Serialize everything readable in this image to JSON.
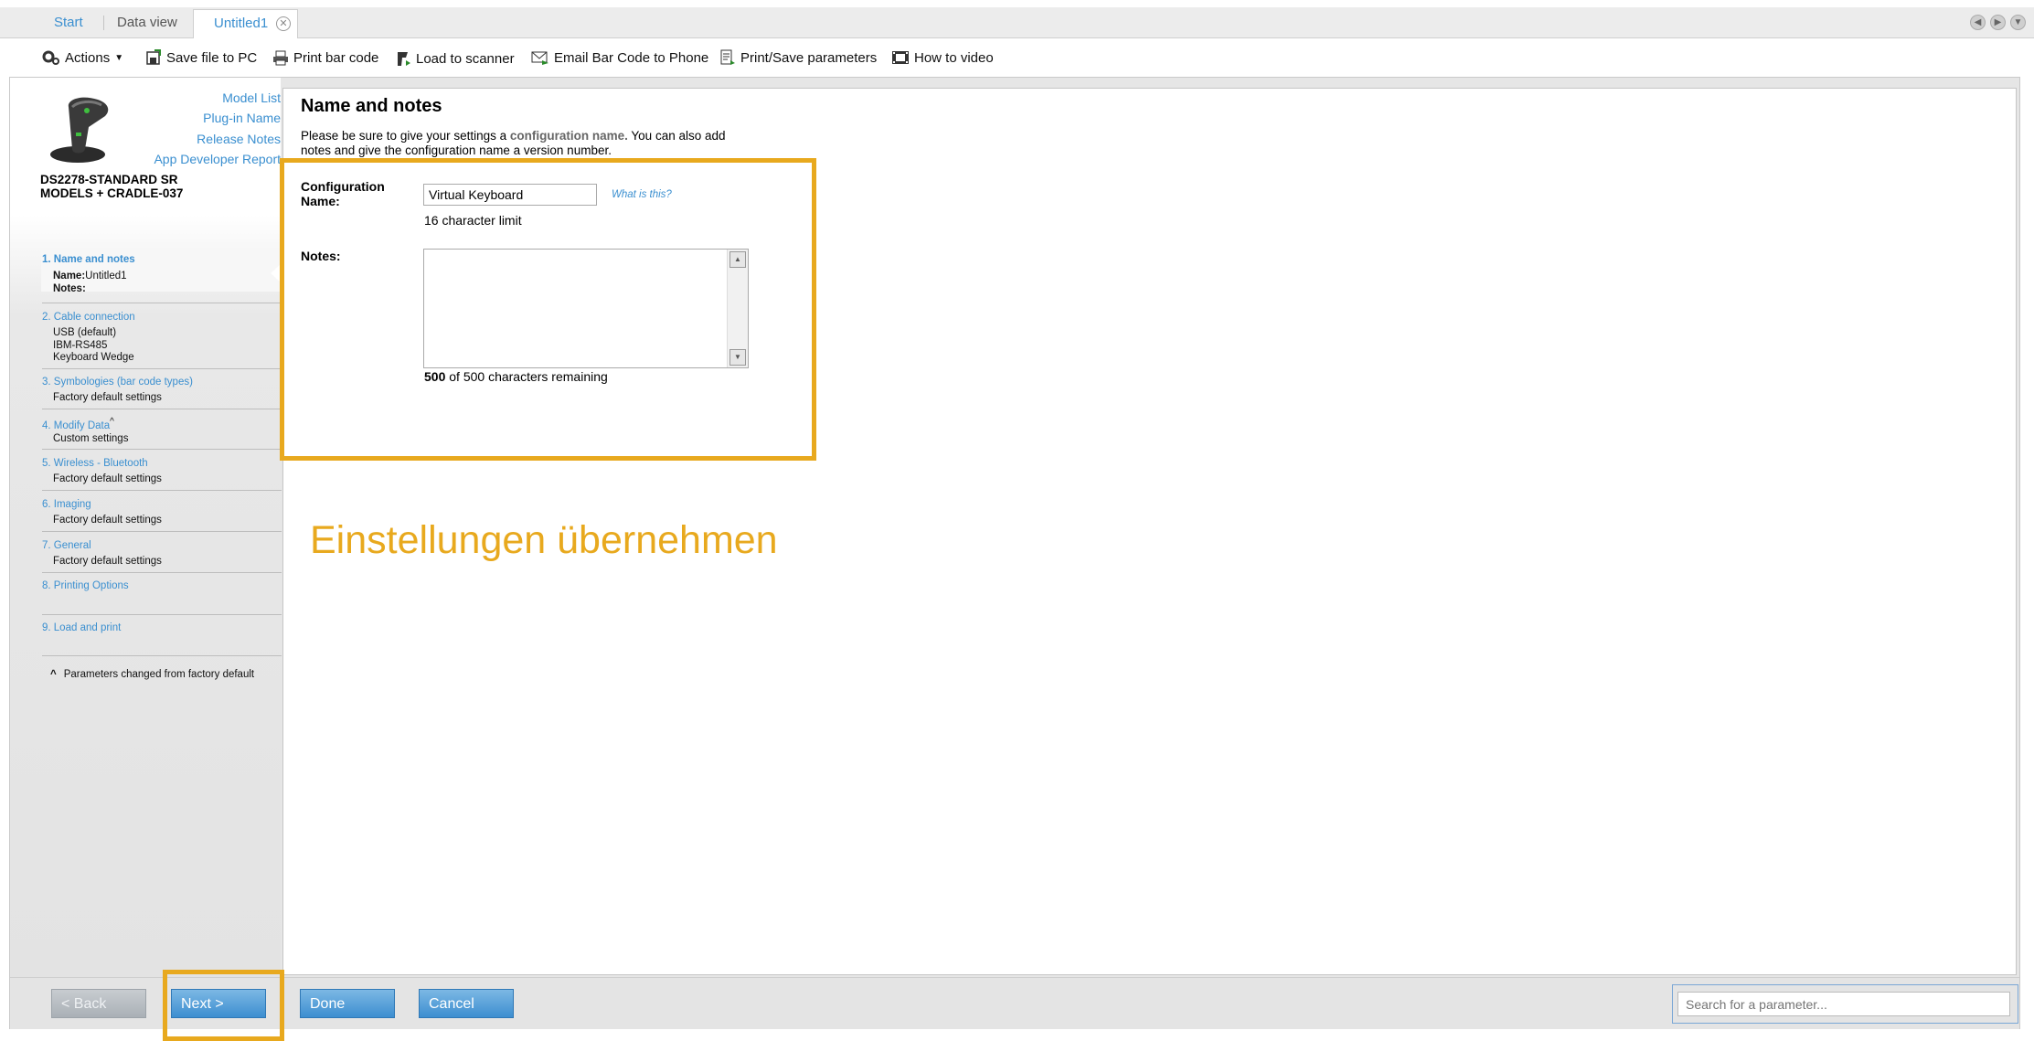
{
  "tabs": [
    {
      "label": "Start"
    },
    {
      "label": "Data view"
    },
    {
      "label": "Untitled1"
    }
  ],
  "toolbar": {
    "actions": "Actions",
    "save_file": "Save file to PC",
    "print_barcode": "Print bar code",
    "load_scanner": "Load to scanner",
    "email_barcode": "Email Bar Code to Phone",
    "print_save_params": "Print/Save parameters",
    "how_to_video": "How to video"
  },
  "sidebar": {
    "links": [
      "Model List",
      "Plug-in Name",
      "Release Notes",
      "App Developer Report"
    ],
    "model_line1": "DS2278-STANDARD SR",
    "model_line2": "MODELS + CRADLE-037",
    "steps": [
      {
        "label": "1.  Name and notes",
        "lines": [
          "Name:",
          "Untitled1",
          "Notes:"
        ]
      },
      {
        "label": "2.  Cable connection",
        "lines": [
          "USB (default)",
          "IBM-RS485",
          "Keyboard Wedge"
        ]
      },
      {
        "label": "3.  Symbologies (bar code types)",
        "lines": [
          "Factory default settings"
        ]
      },
      {
        "label": "4.  Modify Data",
        "lines": [
          "Custom settings"
        ]
      },
      {
        "label": "5.  Wireless - Bluetooth",
        "lines": [
          "Factory default settings"
        ]
      },
      {
        "label": "6.  Imaging",
        "lines": [
          "Factory default settings"
        ]
      },
      {
        "label": "7.  General",
        "lines": [
          "Factory default settings"
        ]
      },
      {
        "label": "8.  Printing Options",
        "lines": []
      },
      {
        "label": "9.  Load and print",
        "lines": []
      }
    ],
    "caret_mark": "^",
    "footnote": "Parameters changed from factory default"
  },
  "main": {
    "title": "Name and notes",
    "intro_a": "Please be sure to give your settings a ",
    "intro_bold": "configuration name.",
    "intro_b": " You can also add",
    "intro_line2": "notes and give the configuration name a version number.",
    "config_label_1": "Configuration",
    "config_label_2": "Name:",
    "config_value": "Virtual Keyboard",
    "what_is_this": "What is this?",
    "char_limit": "16 character limit",
    "notes_label": "Notes:",
    "notes_value": "",
    "remaining_count": "500",
    "remaining_text": " of 500 characters remaining"
  },
  "overlay_text": "Einstellungen übernehmen",
  "buttons": {
    "back": "< Back",
    "next": "Next >",
    "done": "Done",
    "cancel": "Cancel"
  },
  "search": {
    "placeholder": "Search for a parameter..."
  },
  "colors": {
    "accent": "#3a8fd0",
    "highlight": "#e8a91e"
  }
}
